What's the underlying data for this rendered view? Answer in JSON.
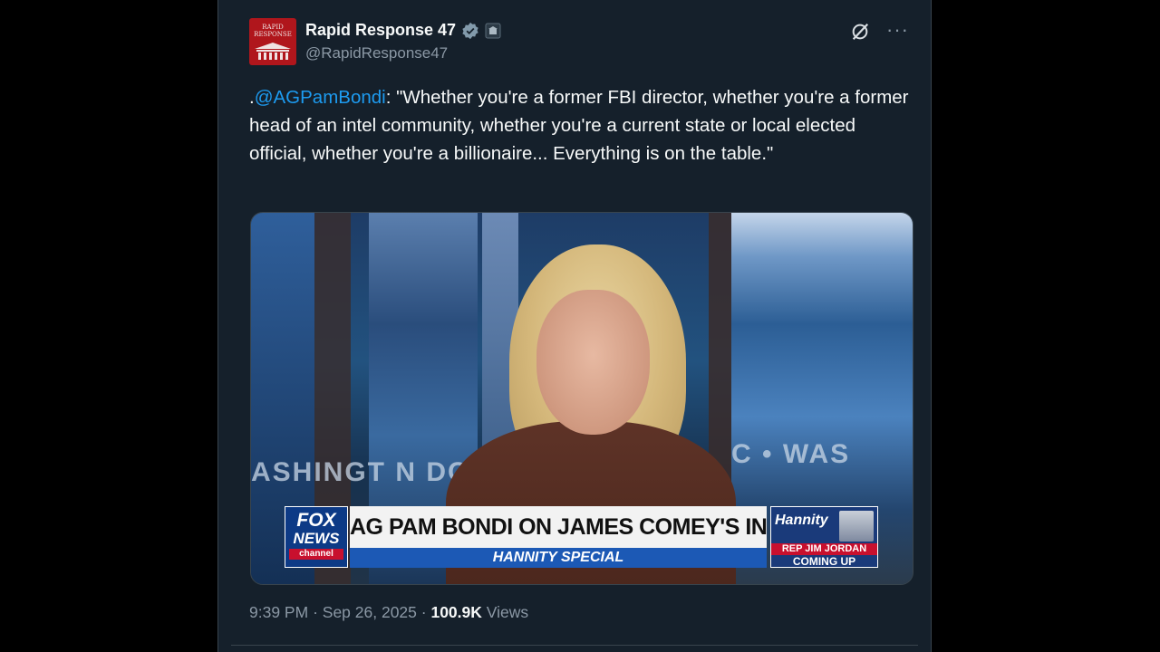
{
  "tweet": {
    "author_name": "Rapid Response 47",
    "handle": "@RapidResponse47",
    "avatar_text_line1": "RAPID",
    "avatar_text_line2": "RESPONSE",
    "text_prefix": ".",
    "mention": "@AGPamBondi",
    "text_body": ": \"Whether you're a former FBI director, whether you're a former head of an intel community, whether you're a current state or local elected official, whether you're a billionaire... Everything is on the table.\"",
    "time": "9:39 PM",
    "date": "Sep 26, 2025",
    "separator": "·",
    "views_count": "100.9K",
    "views_label": "Views",
    "more_label": "···"
  },
  "media": {
    "studio_text_left": "ASHINGT N DC",
    "studio_text_right": "C • WAS",
    "network_line1": "FOX",
    "network_line2": "NEWS",
    "network_line3": "channel",
    "headline": "AG PAM BONDI ON JAMES COMEY'S INDICTMENT",
    "subline": "HANNITY SPECIAL",
    "promo_show": "Hannity",
    "promo_line1": "REP JIM JORDAN",
    "promo_line2": "COMING UP"
  },
  "colors": {
    "background": "#15202b",
    "text": "#f7f9f9",
    "secondary_text": "#8b98a5",
    "link": "#1d9bf0",
    "border": "#38444d"
  },
  "icons": [
    "verified-badge-icon",
    "affiliate-badge-icon",
    "grok-icon",
    "more-icon"
  ]
}
